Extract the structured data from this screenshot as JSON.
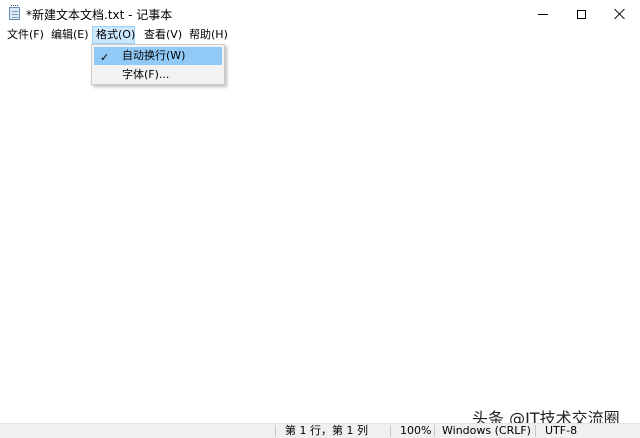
{
  "window": {
    "title": "*新建文本文档.txt - 记事本"
  },
  "menubar": {
    "items": [
      {
        "label": "文件(F)"
      },
      {
        "label": "编辑(E)"
      },
      {
        "label": "格式(O)"
      },
      {
        "label": "查看(V)"
      },
      {
        "label": "帮助(H)"
      }
    ]
  },
  "format_menu": {
    "items": [
      {
        "label": "自动换行(W)",
        "checked": true,
        "check_glyph": "✓"
      },
      {
        "label": "字体(F)..."
      }
    ]
  },
  "editor": {
    "content": ""
  },
  "statusbar": {
    "position": "第 1 行，第 1 列",
    "zoom": "100%",
    "line_ending": "Windows (CRLF)",
    "encoding": "UTF-8"
  },
  "watermark": {
    "text": "头条 @IT技术交流圈"
  },
  "colors": {
    "menu_active_bg": "#cce8ff",
    "dropdown_highlight": "#91c9f7",
    "dropdown_bg": "#f2f2f2",
    "statusbar_bg": "#f0f0f0"
  }
}
